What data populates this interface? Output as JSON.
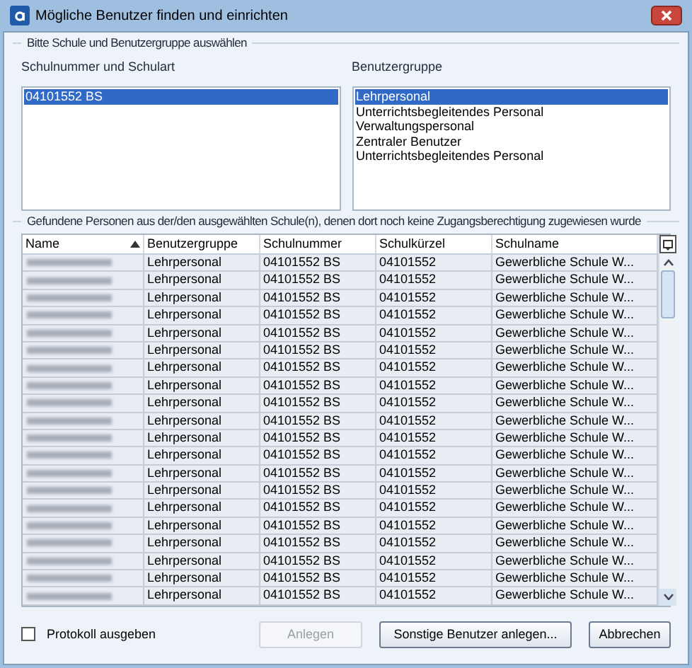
{
  "window": {
    "title": "Mögliche Benutzer finden und einrichten"
  },
  "selection_group": {
    "title": "Bitte Schule und Benutzergruppe auswählen",
    "schools": {
      "label": "Schulnummer und Schulart",
      "items": [
        {
          "text": "04101552 BS",
          "selected": true
        }
      ]
    },
    "user_groups": {
      "label": "Benutzergruppe",
      "items": [
        {
          "text": "Lehrpersonal",
          "selected": true
        },
        {
          "text": "Unterrichtsbegleitendes Personal",
          "selected": false
        },
        {
          "text": "Verwaltungspersonal",
          "selected": false
        },
        {
          "text": "Zentraler Benutzer",
          "selected": false
        },
        {
          "text": "Unterrichtsbegleitendes Personal",
          "selected": false
        }
      ]
    }
  },
  "results_group": {
    "title": "Gefundene Personen aus der/den ausgewählten Schule(n), denen dort noch keine Zugangsberechtigung zugewiesen wurde",
    "table": {
      "columns": [
        {
          "label": "Name",
          "sorted": true
        },
        {
          "label": "Benutzergruppe",
          "sorted": false
        },
        {
          "label": "Schulnummer",
          "sorted": false
        },
        {
          "label": "Schulkürzel",
          "sorted": false
        },
        {
          "label": "Schulname",
          "sorted": false
        }
      ],
      "rows": [
        {
          "name_redacted": true,
          "cells": [
            "",
            "Lehrpersonal",
            "04101552 BS",
            "04101552",
            "Gewerbliche Schule W..."
          ]
        },
        {
          "name_redacted": true,
          "cells": [
            "",
            "Lehrpersonal",
            "04101552 BS",
            "04101552",
            "Gewerbliche Schule W..."
          ]
        },
        {
          "name_redacted": true,
          "cells": [
            "",
            "Lehrpersonal",
            "04101552 BS",
            "04101552",
            "Gewerbliche Schule W..."
          ]
        },
        {
          "name_redacted": true,
          "cells": [
            "",
            "Lehrpersonal",
            "04101552 BS",
            "04101552",
            "Gewerbliche Schule W..."
          ]
        },
        {
          "name_redacted": true,
          "cells": [
            "",
            "Lehrpersonal",
            "04101552 BS",
            "04101552",
            "Gewerbliche Schule W..."
          ]
        },
        {
          "name_redacted": true,
          "cells": [
            "",
            "Lehrpersonal",
            "04101552 BS",
            "04101552",
            "Gewerbliche Schule W..."
          ]
        },
        {
          "name_redacted": true,
          "cells": [
            "",
            "Lehrpersonal",
            "04101552 BS",
            "04101552",
            "Gewerbliche Schule W..."
          ]
        },
        {
          "name_redacted": true,
          "cells": [
            "",
            "Lehrpersonal",
            "04101552 BS",
            "04101552",
            "Gewerbliche Schule W..."
          ]
        },
        {
          "name_redacted": true,
          "cells": [
            "",
            "Lehrpersonal",
            "04101552 BS",
            "04101552",
            "Gewerbliche Schule W..."
          ]
        },
        {
          "name_redacted": true,
          "cells": [
            "",
            "Lehrpersonal",
            "04101552 BS",
            "04101552",
            "Gewerbliche Schule W..."
          ]
        },
        {
          "name_redacted": true,
          "cells": [
            "",
            "Lehrpersonal",
            "04101552 BS",
            "04101552",
            "Gewerbliche Schule W..."
          ]
        },
        {
          "name_redacted": true,
          "cells": [
            "",
            "Lehrpersonal",
            "04101552 BS",
            "04101552",
            "Gewerbliche Schule W..."
          ]
        },
        {
          "name_redacted": true,
          "cells": [
            "",
            "Lehrpersonal",
            "04101552 BS",
            "04101552",
            "Gewerbliche Schule W..."
          ]
        },
        {
          "name_redacted": true,
          "cells": [
            "",
            "Lehrpersonal",
            "04101552 BS",
            "04101552",
            "Gewerbliche Schule W..."
          ]
        },
        {
          "name_redacted": true,
          "cells": [
            "",
            "Lehrpersonal",
            "04101552 BS",
            "04101552",
            "Gewerbliche Schule W..."
          ]
        },
        {
          "name_redacted": true,
          "cells": [
            "",
            "Lehrpersonal",
            "04101552 BS",
            "04101552",
            "Gewerbliche Schule W..."
          ]
        },
        {
          "name_redacted": true,
          "cells": [
            "",
            "Lehrpersonal",
            "04101552 BS",
            "04101552",
            "Gewerbliche Schule W..."
          ]
        },
        {
          "name_redacted": true,
          "cells": [
            "",
            "Lehrpersonal",
            "04101552 BS",
            "04101552",
            "Gewerbliche Schule W..."
          ]
        },
        {
          "name_redacted": true,
          "cells": [
            "",
            "Lehrpersonal",
            "04101552 BS",
            "04101552",
            "Gewerbliche Schule W..."
          ]
        },
        {
          "name_redacted": true,
          "cells": [
            "",
            "Lehrpersonal",
            "04101552 BS",
            "04101552",
            "Gewerbliche Schule W..."
          ]
        }
      ]
    }
  },
  "footer": {
    "log_checkbox": {
      "label": "Protokoll ausgeben",
      "checked": false
    },
    "buttons": [
      {
        "label": "Anlegen",
        "disabled": true
      },
      {
        "label": "Sonstige Benutzer anlegen...",
        "disabled": false
      },
      {
        "label": "Abbrechen",
        "disabled": false
      }
    ]
  }
}
